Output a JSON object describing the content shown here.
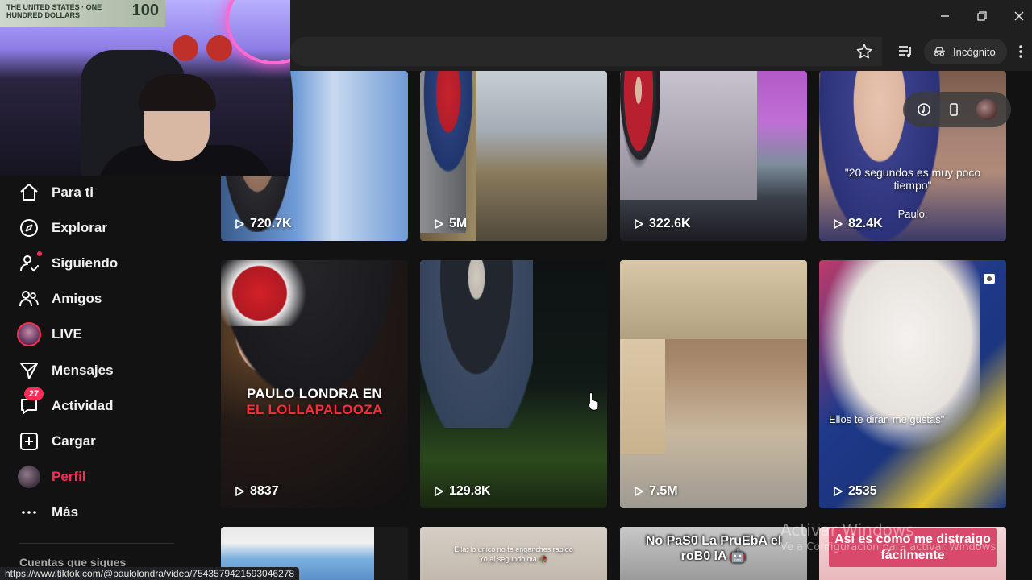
{
  "browser": {
    "incognito_label": "Incógnito",
    "status_url": "https://www.tiktok.com/@paulolondra/video/7543579421593046278"
  },
  "webcam": {
    "bill_text": "THE UNITED STATES · ONE HUNDRED DOLLARS",
    "bill_value": "100"
  },
  "sidebar": {
    "items": [
      {
        "label": "Para ti",
        "icon": "home-icon"
      },
      {
        "label": "Explorar",
        "icon": "compass-icon"
      },
      {
        "label": "Siguiendo",
        "icon": "following-icon"
      },
      {
        "label": "Amigos",
        "icon": "friends-icon"
      },
      {
        "label": "LIVE",
        "icon": "live-avatar"
      },
      {
        "label": "Mensajes",
        "icon": "send-icon"
      },
      {
        "label": "Actividad",
        "icon": "activity-icon",
        "badge": "27"
      },
      {
        "label": "Cargar",
        "icon": "upload-icon"
      },
      {
        "label": "Perfil",
        "icon": "profile-avatar",
        "active": true
      },
      {
        "label": "Más",
        "icon": "more-icon"
      }
    ],
    "following_title": "Cuentas que sigues"
  },
  "videos": [
    {
      "views": "720.7K"
    },
    {
      "views": "5M"
    },
    {
      "views": "322.6K"
    },
    {
      "views": "82.4K",
      "caption": "\"20 segundos es muy poco tiempo\"",
      "caption2": "Paulo:"
    },
    {
      "views": "8837",
      "caption": "PAULO LONDRA EN",
      "caption_hl": "EL LOLLAPALOOZA"
    },
    {
      "views": "129.8K"
    },
    {
      "views": "7.5M"
    },
    {
      "views": "2535",
      "caption": "Ellos te diran me gustas\""
    },
    {
      "caption": ""
    },
    {
      "caption": "Ella: lo unico no te enganches rapido",
      "caption2": "Yo al segundo dia 🥀"
    },
    {
      "caption": "No PaS0 La PruEbA el roB0 IA 🤖"
    },
    {
      "caption": "Asi es como me distraigo fácilmente"
    }
  ],
  "watermark": {
    "line1": "Activar Windows",
    "line2": "Ve a Configuración para activar Windows."
  },
  "colors": {
    "accent": "#fe2c55",
    "background": "#121212"
  }
}
